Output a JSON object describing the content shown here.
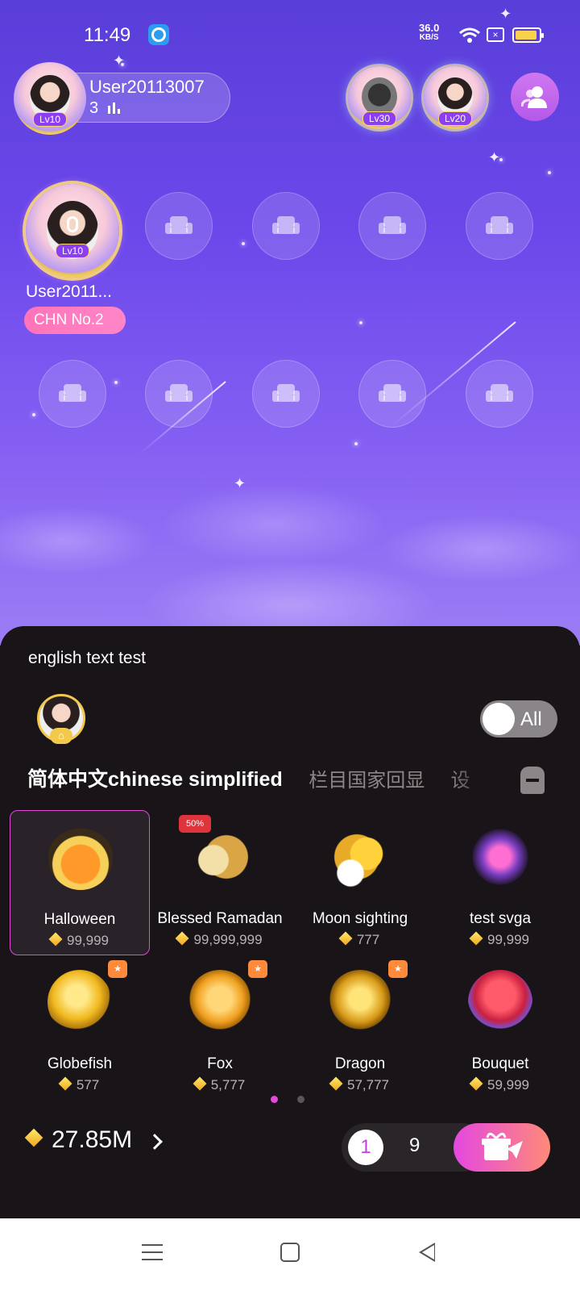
{
  "status_bar": {
    "time": "11:49",
    "net_speed_value": "36.0",
    "net_speed_unit": "KB/S",
    "icons": [
      "app-notification-icon",
      "wifi-icon",
      "sim-icon",
      "battery-icon"
    ]
  },
  "room": {
    "host": {
      "name": "User20113007",
      "level": "Lv10",
      "audience_count": "3"
    },
    "top_fans": [
      {
        "level": "Lv30"
      },
      {
        "level": "Lv20"
      }
    ],
    "host_seat": {
      "name": "User2011...",
      "level": "Lv10",
      "rank": "CHN No.2"
    },
    "empty_seat_icon": "sofa-icon"
  },
  "gift_panel": {
    "message": "english text test",
    "all_toggle_label": "All",
    "tabs": [
      "简体中文chinese simplified",
      "栏目国家回显",
      "设"
    ],
    "gifts": [
      {
        "name": "Halloween",
        "price": "99,999",
        "selected": true
      },
      {
        "name": "Blessed Ramadan",
        "price": "99,999,999",
        "tag": "50%"
      },
      {
        "name": "Moon sighting",
        "price": "777"
      },
      {
        "name": "test svga",
        "price": "99,999"
      },
      {
        "name": "Globefish",
        "price": "577"
      },
      {
        "name": "Fox",
        "price": "5,777"
      },
      {
        "name": "Dragon",
        "price": "57,777"
      },
      {
        "name": "Bouquet",
        "price": "59,999"
      }
    ],
    "page_count": 2,
    "current_page": 1,
    "balance": "27.85M",
    "quantity_options": [
      "1",
      "9"
    ],
    "colors": {
      "accent": "#e04ad6",
      "diamond": "#f0c020",
      "panel_bg": "#181418",
      "rank_pink": "#ff73b8"
    }
  }
}
